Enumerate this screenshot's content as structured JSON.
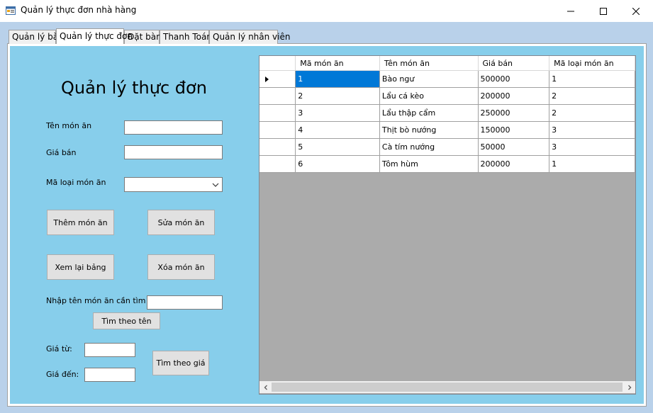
{
  "window": {
    "title": "Quản lý thực đơn nhà hàng",
    "accent": "#0078d7"
  },
  "tabs": [
    {
      "label": "Quản lý bàn"
    },
    {
      "label": "Quản lý thực đơn"
    },
    {
      "label": "Đặt bàn"
    },
    {
      "label": "Thanh Toán"
    },
    {
      "label": "Quản lý nhân viên"
    }
  ],
  "form": {
    "heading": "Quản lý thực đơn",
    "ten_mon_an_label": "Tên món ăn",
    "ten_mon_an_value": "",
    "gia_ban_label": "Giá bán",
    "gia_ban_value": "",
    "ma_loai_label": "Mã loại món ăn",
    "ma_loai_value": "",
    "them_button": "Thêm món ăn",
    "sua_button": "Sửa món ăn",
    "xem_lai_button": "Xem lại bảng",
    "xoa_button": "Xóa món ăn",
    "search_name_label": "Nhập tên món ăn cần tìm",
    "search_name_value": "",
    "search_name_button": "Tìm theo tên",
    "gia_tu_label": "Giá từ:",
    "gia_tu_value": "",
    "gia_den_label": "Giá đến:",
    "gia_den_value": "",
    "search_price_button": "Tìm theo giá"
  },
  "grid": {
    "columns": [
      "Mã món ăn",
      "Tên món ăn",
      "Giá bán",
      "Mã loại món ăn"
    ],
    "rows": [
      [
        "1",
        "Bào ngư",
        "500000",
        "1"
      ],
      [
        "2",
        "Lẩu cá kèo",
        "200000",
        "2"
      ],
      [
        "3",
        "Lẩu thập cẩm",
        "250000",
        "2"
      ],
      [
        "4",
        "Thịt bò nướng",
        "150000",
        "3"
      ],
      [
        "5",
        "Cà tím nướng",
        "50000",
        "3"
      ],
      [
        "6",
        "Tôm hùm",
        "200000",
        "1"
      ]
    ],
    "selected_row": 0
  },
  "icons": {
    "app": "app-form-icon",
    "minimize": "minimize-icon",
    "maximize": "maximize-icon",
    "close": "close-icon",
    "combo_arrow": "chevron-down-icon",
    "row_pointer": "row-pointer-icon",
    "scroll_left": "scroll-left-icon",
    "scroll_right": "scroll-right-icon"
  }
}
